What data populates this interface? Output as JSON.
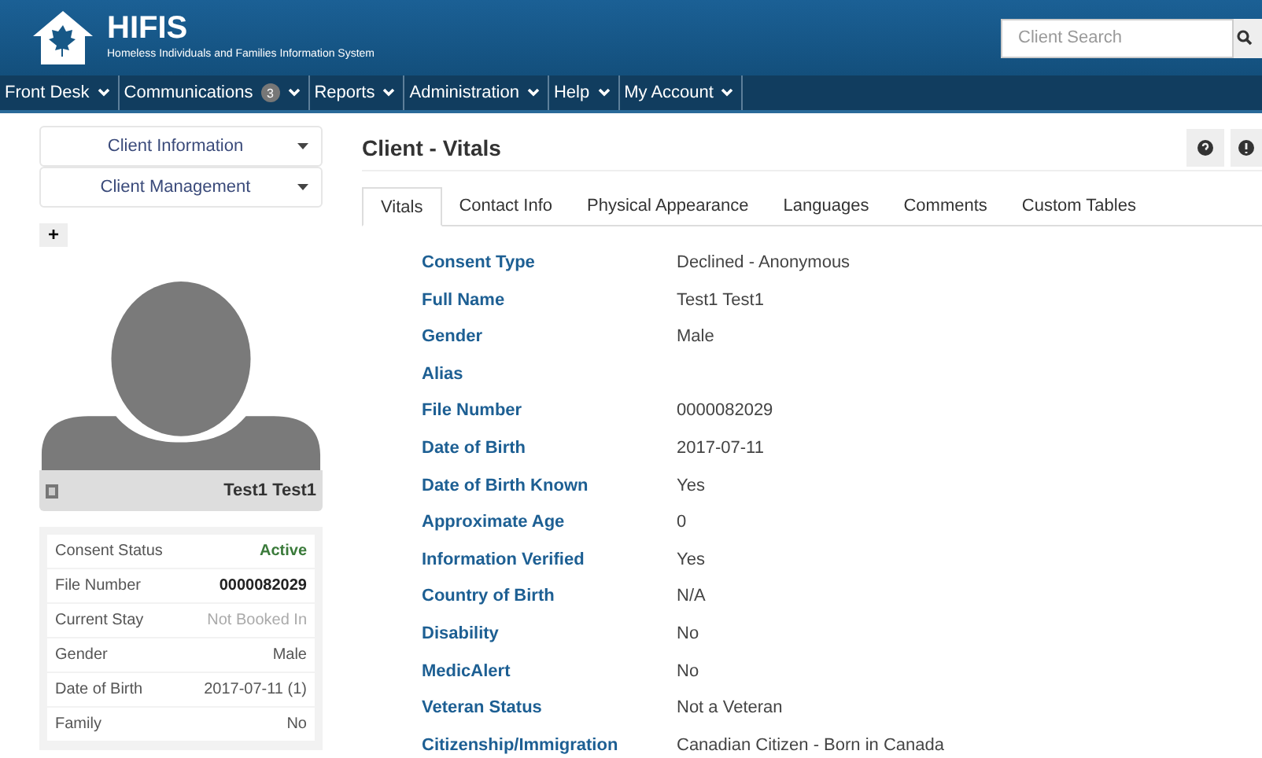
{
  "header": {
    "app_name": "HIFIS",
    "subtitle": "Homeless Individuals and Families Information System",
    "search": {
      "placeholder": "Client Search"
    }
  },
  "nav": [
    {
      "label": "Front Desk"
    },
    {
      "label": "Communications",
      "badge": "3"
    },
    {
      "label": "Reports"
    },
    {
      "label": "Administration"
    },
    {
      "label": "Help"
    },
    {
      "label": "My Account"
    }
  ],
  "sidebar": {
    "menus": [
      {
        "label": "Client Information",
        "expanded": false
      },
      {
        "label": "Client Management",
        "expanded": false
      }
    ],
    "add_button": "+",
    "client_name": "Test1 Test1",
    "summary": [
      {
        "label": "Consent Status",
        "value": "Active",
        "kind": "status"
      },
      {
        "label": "File Number",
        "value": "0000082029",
        "kind": "strong"
      },
      {
        "label": "Current Stay",
        "value": "Not Booked In",
        "kind": "muted"
      },
      {
        "label": "Gender",
        "value": "Male",
        "kind": "plain"
      },
      {
        "label": "Date of Birth",
        "value": "2017-07-11 (1)",
        "kind": "plain"
      },
      {
        "label": "Family",
        "value": "No",
        "kind": "plain"
      }
    ]
  },
  "main": {
    "title": "Client - Vitals",
    "tabs": [
      {
        "label": "Vitals",
        "selected": true
      },
      {
        "label": "Contact Info",
        "selected": false
      },
      {
        "label": "Physical Appearance",
        "selected": false
      },
      {
        "label": "Languages",
        "selected": false
      },
      {
        "label": "Comments",
        "selected": false
      },
      {
        "label": "Custom Tables",
        "selected": false
      }
    ],
    "fields": [
      {
        "label": "Consent Type",
        "value": "Declined - Anonymous"
      },
      {
        "label": "Full Name",
        "value": "Test1 Test1"
      },
      {
        "label": "Gender",
        "value": "Male"
      },
      {
        "label": "Alias"
      },
      {
        "label": "File Number",
        "value": "0000082029"
      },
      {
        "label": "Date of Birth",
        "value": "2017-07-11"
      },
      {
        "label": "Date of Birth Known",
        "value": "Yes"
      },
      {
        "label": "Approximate Age",
        "value": "0"
      },
      {
        "label": "Information Verified",
        "value": "Yes"
      },
      {
        "label": "Country of Birth",
        "value": "N/A"
      },
      {
        "label": "Disability",
        "value": "No"
      },
      {
        "label": "MedicAlert",
        "value": "No"
      },
      {
        "label": "Veteran Status",
        "value": "Not a Veteran"
      },
      {
        "label": "Citizenship/Immigration",
        "value": "Canadian Citizen - Born in Canada"
      }
    ]
  }
}
